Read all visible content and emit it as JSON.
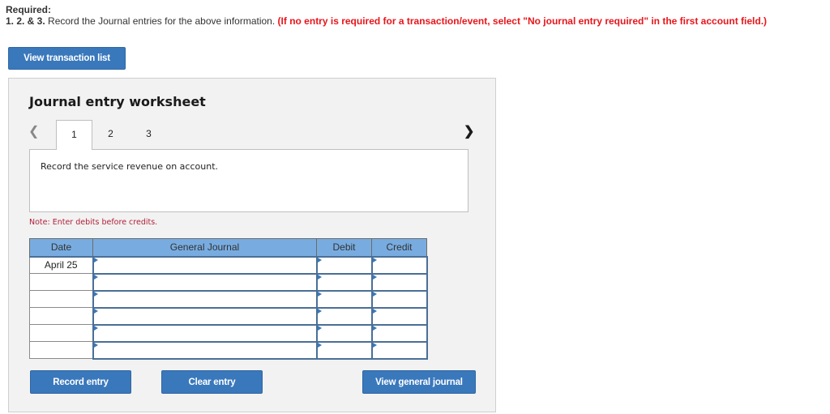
{
  "header": {
    "required_label": "Required:",
    "instruction_numbers": "1. 2. & 3.",
    "instruction_text": " Record the Journal entries for the above information. ",
    "instruction_warning": "(If no entry is required for a transaction/event, select \"No journal entry required\" in the first account field.)"
  },
  "buttons": {
    "view_transaction_list": "View transaction list",
    "record_entry": "Record entry",
    "clear_entry": "Clear entry",
    "view_general_journal": "View general journal"
  },
  "worksheet": {
    "title": "Journal entry worksheet",
    "tabs": [
      {
        "label": "1",
        "active": true
      },
      {
        "label": "2",
        "active": false
      },
      {
        "label": "3",
        "active": false
      }
    ],
    "prev_icon": "chevron-left",
    "next_icon": "chevron-right",
    "description": "Record the service revenue on account.",
    "note": "Note: Enter debits before credits."
  },
  "journal": {
    "columns": [
      "Date",
      "General Journal",
      "Debit",
      "Credit"
    ],
    "rows": [
      {
        "date": "April 25",
        "account": "",
        "debit": "",
        "credit": ""
      },
      {
        "date": "",
        "account": "",
        "debit": "",
        "credit": ""
      },
      {
        "date": "",
        "account": "",
        "debit": "",
        "credit": ""
      },
      {
        "date": "",
        "account": "",
        "debit": "",
        "credit": ""
      },
      {
        "date": "",
        "account": "",
        "debit": "",
        "credit": ""
      },
      {
        "date": "",
        "account": "",
        "debit": "",
        "credit": ""
      }
    ]
  },
  "colors": {
    "button_blue": "#3a78bc",
    "table_header": "#78ace0",
    "warning_red": "#e8151b",
    "note_red": "#b0203a"
  }
}
